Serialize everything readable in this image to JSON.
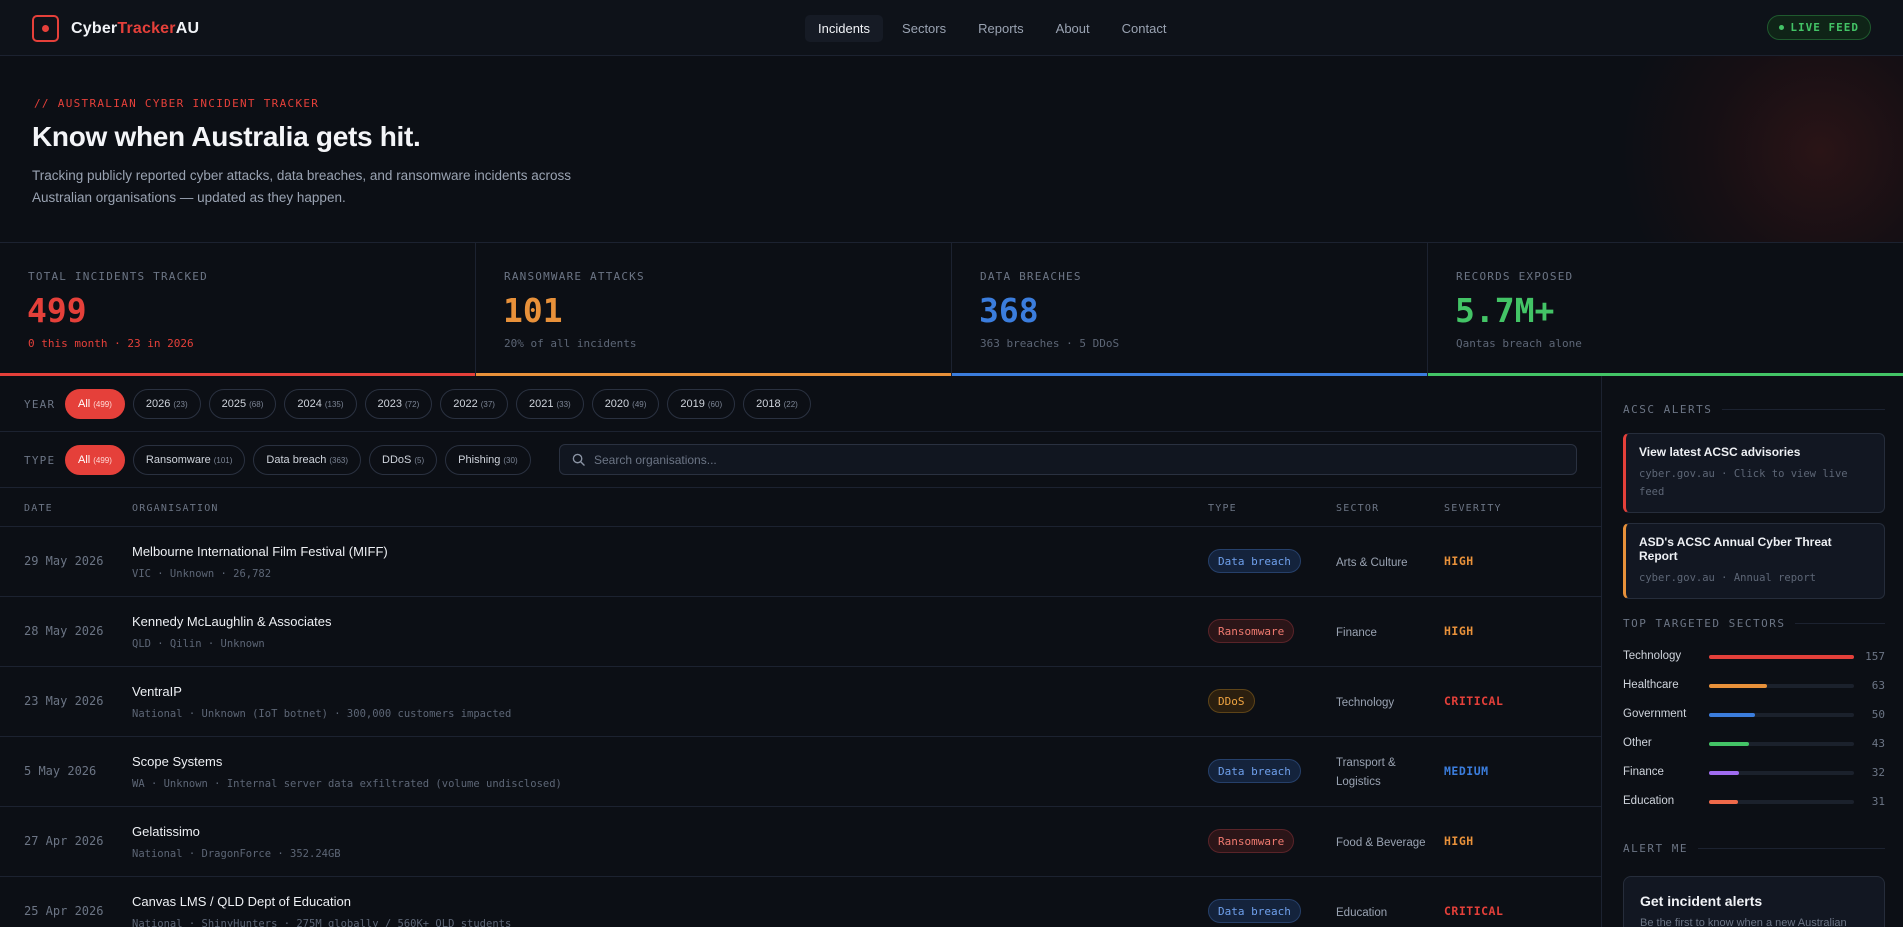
{
  "brand": {
    "name_a": "Cyber",
    "name_b": "Tracker",
    "name_c": "AU"
  },
  "nav": {
    "links": [
      "Incidents",
      "Sectors",
      "Reports",
      "About",
      "Contact"
    ],
    "live": "LIVE FEED"
  },
  "hero": {
    "eyebrow": "// AUSTRALIAN CYBER INCIDENT TRACKER",
    "title": "Know when Australia gets hit.",
    "desc": "Tracking publicly reported cyber attacks, data breaches, and ransomware incidents across Australian organisations — updated as they happen."
  },
  "stats": [
    {
      "label": "TOTAL INCIDENTS TRACKED",
      "value": "499",
      "sub": "0 this month · 23 in 2026",
      "color": "#e5403a"
    },
    {
      "label": "RANSOMWARE ATTACKS",
      "value": "101",
      "sub": "20% of all incidents",
      "color": "#e8913a"
    },
    {
      "label": "DATA BREACHES",
      "value": "368",
      "sub": "363 breaches · 5 DDoS",
      "color": "#3b7ddd"
    },
    {
      "label": "RECORDS EXPOSED",
      "value": "5.7M+",
      "sub": "Qantas breach alone",
      "color": "#43c466"
    }
  ],
  "filters": {
    "year_label": "YEAR",
    "years": [
      {
        "label": "All",
        "count": "(499)"
      },
      {
        "label": "2026",
        "count": "(23)"
      },
      {
        "label": "2025",
        "count": "(68)"
      },
      {
        "label": "2024",
        "count": "(135)"
      },
      {
        "label": "2023",
        "count": "(72)"
      },
      {
        "label": "2022",
        "count": "(37)"
      },
      {
        "label": "2021",
        "count": "(33)"
      },
      {
        "label": "2020",
        "count": "(49)"
      },
      {
        "label": "2019",
        "count": "(60)"
      },
      {
        "label": "2018",
        "count": "(22)"
      }
    ],
    "type_label": "TYPE",
    "types": [
      {
        "label": "All",
        "count": "(499)"
      },
      {
        "label": "Ransomware",
        "count": "(101)"
      },
      {
        "label": "Data breach",
        "count": "(363)"
      },
      {
        "label": "DDoS",
        "count": "(5)"
      },
      {
        "label": "Phishing",
        "count": "(30)"
      }
    ],
    "search_placeholder": "Search organisations..."
  },
  "table": {
    "headers": [
      "DATE",
      "ORGANISATION",
      "TYPE",
      "SECTOR",
      "SEVERITY"
    ],
    "rows": [
      {
        "date": "29 May 2026",
        "org": "Melbourne International Film Festival (MIFF)",
        "meta": "VIC · Unknown · 26,782",
        "type": "Data breach",
        "kind": "breach",
        "sector": "Arts & Culture",
        "sev": "HIGH",
        "sev_color": "#e8913a"
      },
      {
        "date": "28 May 2026",
        "org": "Kennedy McLaughlin & Associates",
        "meta": "QLD · Qilin · Unknown",
        "type": "Ransomware",
        "kind": "ransom",
        "sector": "Finance",
        "sev": "HIGH",
        "sev_color": "#e8913a"
      },
      {
        "date": "23 May 2026",
        "org": "VentraIP",
        "meta": "National · Unknown (IoT botnet) · 300,000 customers impacted",
        "type": "DDoS",
        "kind": "ddos",
        "sector": "Technology",
        "sev": "CRITICAL",
        "sev_color": "#e5403a"
      },
      {
        "date": "5 May 2026",
        "org": "Scope Systems",
        "meta": "WA · Unknown · Internal server data exfiltrated (volume undisclosed)",
        "type": "Data breach",
        "kind": "breach",
        "sector": "Transport & Logistics",
        "sev": "MEDIUM",
        "sev_color": "#3b7ddd"
      },
      {
        "date": "27 Apr 2026",
        "org": "Gelatissimo",
        "meta": "National · DragonForce · 352.24GB",
        "type": "Ransomware",
        "kind": "ransom",
        "sector": "Food & Beverage",
        "sev": "HIGH",
        "sev_color": "#e8913a"
      },
      {
        "date": "25 Apr 2026",
        "org": "Canvas LMS / QLD Dept of Education",
        "meta": "National · ShinyHunters · 275M globally / 560K+ QLD students",
        "type": "Data breach",
        "kind": "breach",
        "sector": "Education",
        "sev": "CRITICAL",
        "sev_color": "#e5403a"
      }
    ]
  },
  "sidebar": {
    "alerts_title": "ACSC ALERTS",
    "alerts": [
      {
        "title": "View latest ACSC advisories",
        "sub": "cyber.gov.au · Click to view live feed"
      },
      {
        "title": "ASD's ACSC Annual Cyber Threat Report",
        "sub": "cyber.gov.au · Annual report"
      }
    ],
    "sectors_title": "TOP TARGETED SECTORS",
    "sectors": [
      {
        "name": "Technology",
        "value": 157,
        "color": "#e5403a"
      },
      {
        "name": "Healthcare",
        "value": 63,
        "color": "#e8913a"
      },
      {
        "name": "Government",
        "value": 50,
        "color": "#3b7ddd"
      },
      {
        "name": "Other",
        "value": 43,
        "color": "#43c466"
      },
      {
        "name": "Finance",
        "value": 32,
        "color": "#a06cf0"
      },
      {
        "name": "Education",
        "value": 31,
        "color": "#f06a4a"
      }
    ],
    "alert_me_title": "ALERT ME",
    "cta_title": "Get incident alerts",
    "cta_sub": "Be the first to know when a new Australian"
  }
}
